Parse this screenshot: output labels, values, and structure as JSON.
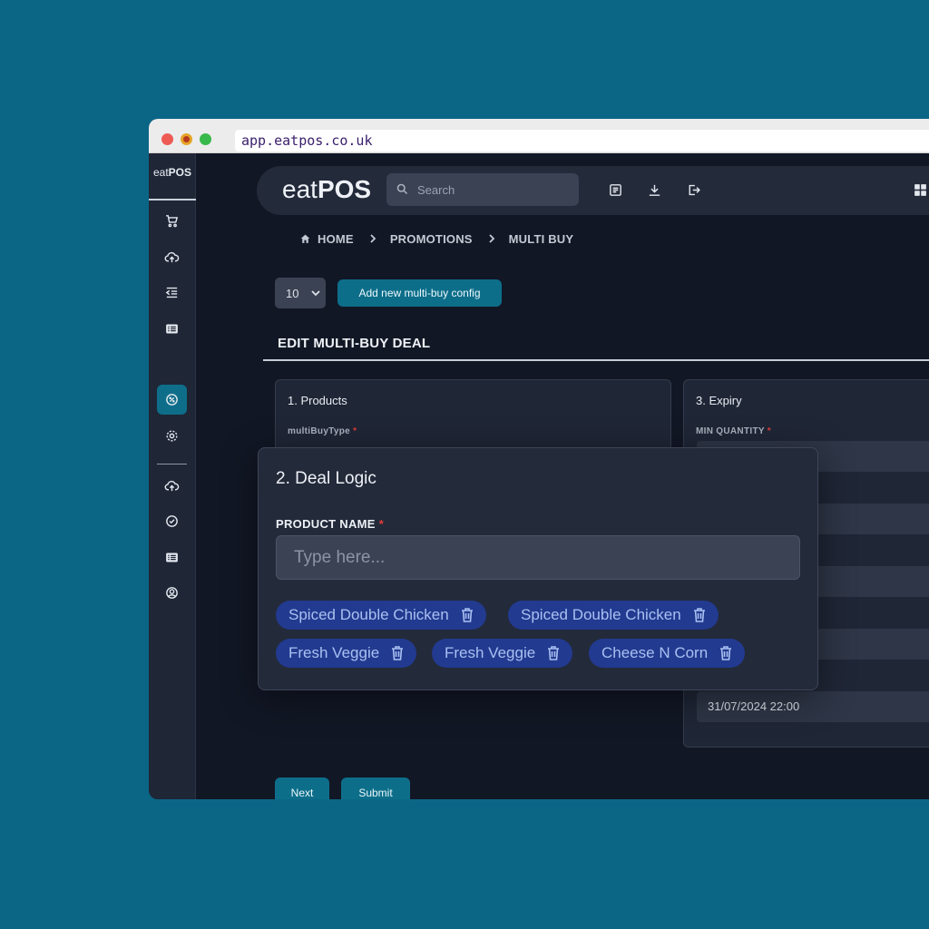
{
  "browser": {
    "url": "app.eatpos.co.uk"
  },
  "sidebar": {
    "logo_light": "eat",
    "logo_bold": "POS",
    "items": [
      {
        "name": "cart-icon"
      },
      {
        "name": "cloud-upload-icon"
      },
      {
        "name": "indent-list-icon"
      },
      {
        "name": "list-icon"
      },
      {
        "name": "promotions-icon",
        "active": true
      },
      {
        "name": "gear-icon"
      },
      {
        "name": "cloud-upload-icon"
      },
      {
        "name": "check-circle-icon"
      },
      {
        "name": "list-icon"
      },
      {
        "name": "user-circle-icon"
      }
    ]
  },
  "header": {
    "brand_light": "eat",
    "brand_bold": "POS",
    "search_placeholder": "Search",
    "icons": [
      "receipt-icon",
      "download-icon",
      "logout-icon",
      "grid-icon"
    ]
  },
  "breadcrumb": {
    "home": "HOME",
    "promotions": "PROMOTIONS",
    "current": "MULTI BUY"
  },
  "toolbar": {
    "page_size": "10",
    "add_button": "Add new multi-buy config"
  },
  "section_title": "EDIT MULTI-BUY DEAL",
  "products_card": {
    "title": "1. Products",
    "field_label": "multiBuyType"
  },
  "expiry_card": {
    "title": "3. Expiry",
    "field_label": "MIN QUANTITY",
    "end_date": "31/07/2024 22:00"
  },
  "deal_logic": {
    "title": "2. Deal Logic",
    "label": "PRODUCT NAME",
    "required": "*",
    "placeholder": "Type here...",
    "chips": [
      "Spiced Double Chicken",
      "Spiced Double Chicken",
      "Fresh Veggie",
      "Fresh Veggie",
      "Cheese N Corn"
    ]
  },
  "buttons": {
    "next": "Next",
    "submit": "Submit"
  },
  "colors": {
    "accent": "#0d6e8a",
    "chip": "#223a8f",
    "background": "#0b6686",
    "required": "#e23b3b"
  }
}
